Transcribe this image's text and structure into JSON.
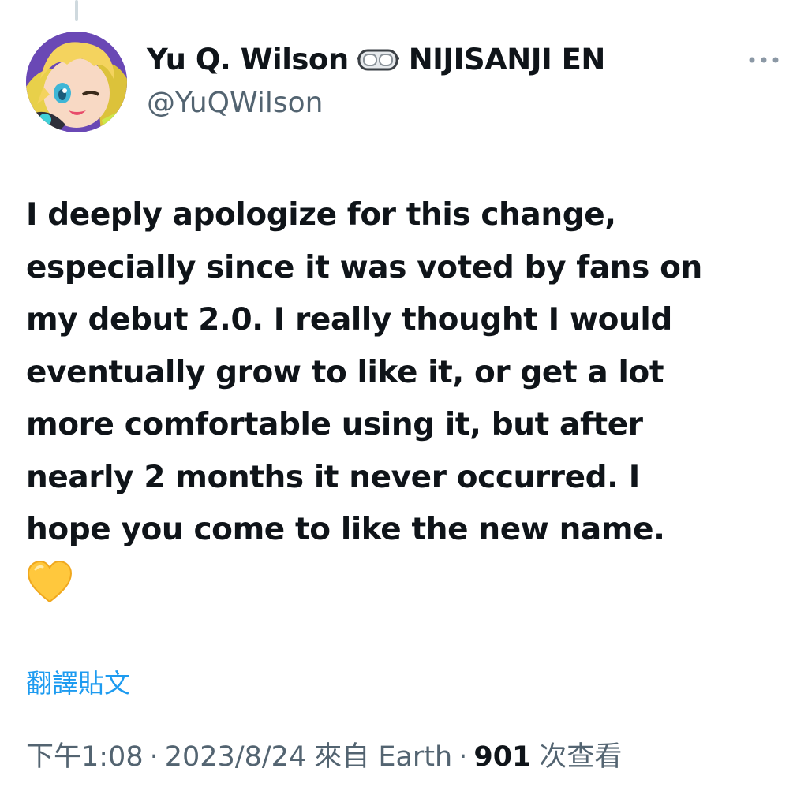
{
  "author": {
    "display_name": "Yu Q. Wilson",
    "affiliation": "NIJISANJI EN",
    "handle": "@YuQWilson",
    "badge_icon": "goggles-icon",
    "avatar_icon": "avatar"
  },
  "tweet": {
    "text": "I deeply apologize for this change,\nespecially since it was voted by fans on\nmy debut 2.0. I really thought I would\neventually grow to like it, or get a lot\nmore comfortable using it, but after\nnearly 2 months it never occurred. I\nhope you come to like the new name.",
    "emoji_icon": "yellow-heart-icon",
    "translate_label": "翻譯貼文"
  },
  "meta": {
    "time": "下午1:08",
    "date": "2023/8/24",
    "source": "來自 Earth",
    "views_count": "901",
    "views_label": "次查看",
    "separator": "·"
  },
  "colors": {
    "text": "#0f1419",
    "secondary": "#536471",
    "link": "#1d9bf0",
    "heart": "#ffc83d"
  }
}
